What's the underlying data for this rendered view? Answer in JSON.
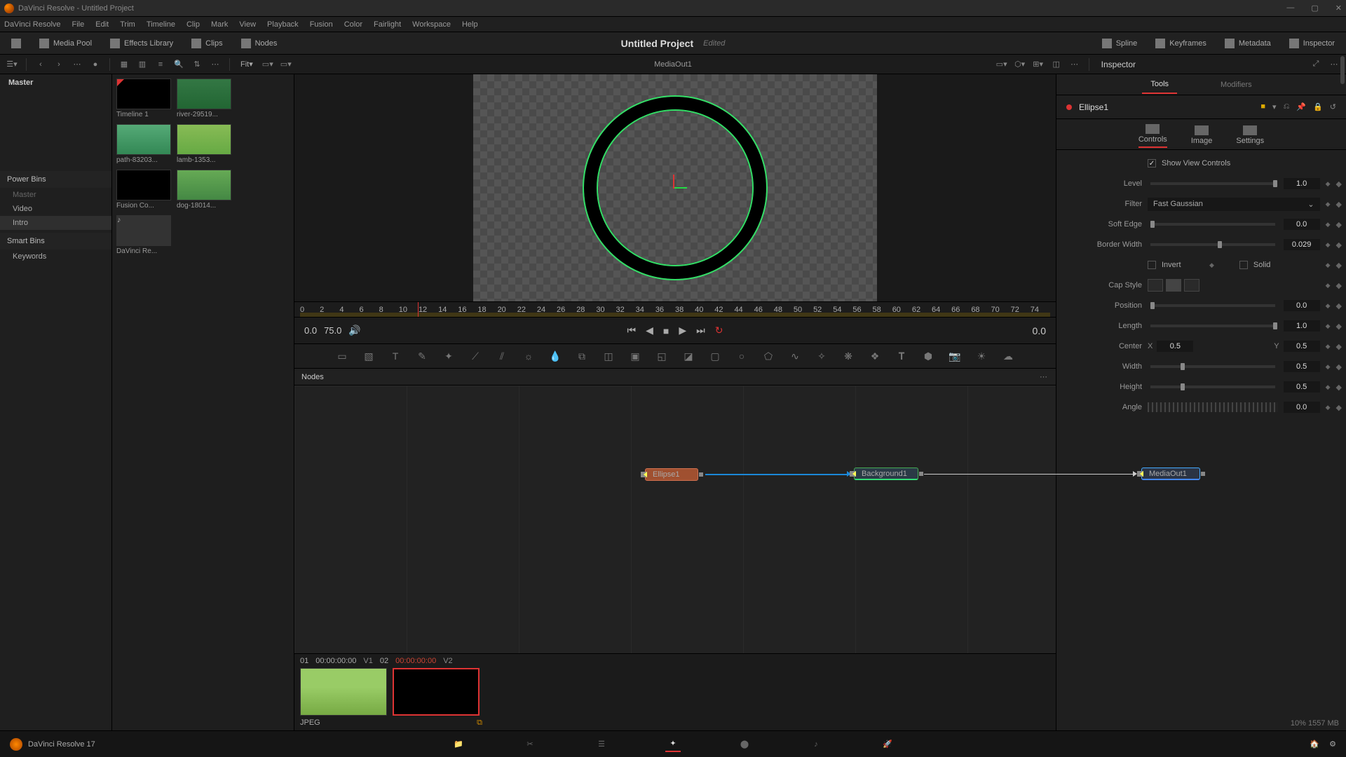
{
  "titlebar": {
    "text": "DaVinci Resolve - Untitled Project"
  },
  "menubar": [
    "DaVinci Resolve",
    "File",
    "Edit",
    "Trim",
    "Timeline",
    "Clip",
    "Mark",
    "View",
    "Playback",
    "Fusion",
    "Color",
    "Fairlight",
    "Workspace",
    "Help"
  ],
  "topbar": {
    "media_pool": "Media Pool",
    "effects_library": "Effects Library",
    "clips": "Clips",
    "nodes": "Nodes",
    "project_name": "Untitled Project",
    "project_state": "Edited",
    "spline": "Spline",
    "keyframes": "Keyframes",
    "metadata": "Metadata",
    "inspector": "Inspector"
  },
  "toolbar2": {
    "fit": "Fit",
    "viewer_label": "MediaOut1",
    "inspector_label": "Inspector"
  },
  "bins": {
    "master": "Master",
    "power_bins": "Power Bins",
    "power_items": [
      "Master",
      "Video",
      "Intro"
    ],
    "smart_bins": "Smart Bins",
    "smart_items": [
      "Keywords"
    ]
  },
  "media_items": [
    {
      "name": "Timeline 1",
      "kind": "timeline"
    },
    {
      "name": "river-29519...",
      "kind": "forest"
    },
    {
      "name": "path-83203...",
      "kind": "path"
    },
    {
      "name": "lamb-1353...",
      "kind": "lamb"
    },
    {
      "name": "Fusion Co...",
      "kind": "fusion"
    },
    {
      "name": "dog-18014...",
      "kind": "dog"
    },
    {
      "name": "DaVinci Re...",
      "kind": "audio"
    }
  ],
  "ruler_ticks": [
    "0",
    "2",
    "4",
    "6",
    "8",
    "10",
    "12",
    "14",
    "16",
    "18",
    "20",
    "22",
    "24",
    "26",
    "28",
    "30",
    "32",
    "34",
    "36",
    "38",
    "40",
    "42",
    "44",
    "46",
    "48",
    "50",
    "52",
    "54",
    "56",
    "58",
    "60",
    "62",
    "64",
    "66",
    "68",
    "70",
    "72",
    "74"
  ],
  "transport": {
    "start": "0.0",
    "end": "75.0",
    "current": "0.0"
  },
  "nodes_hdr": "Nodes",
  "nodes": {
    "ellipse": "Ellipse1",
    "background": "Background1",
    "mediaout": "MediaOut1"
  },
  "clipstrip": {
    "idx1": "01",
    "tc1": "00:00:00:00",
    "v1": "V1",
    "idx2": "02",
    "tc2": "00:00:00:00",
    "v2": "V2",
    "format": "JPEG"
  },
  "mem": "10%   1557 MB",
  "pagebar": {
    "app": "DaVinci Resolve 17"
  },
  "inspector": {
    "tabs": {
      "tools": "Tools",
      "modifiers": "Modifiers"
    },
    "node": "Ellipse1",
    "subtabs": {
      "controls": "Controls",
      "image": "Image",
      "settings": "Settings"
    },
    "show_view_controls": "Show View Controls",
    "level_lbl": "Level",
    "level_val": "1.0",
    "filter_lbl": "Filter",
    "filter_val": "Fast Gaussian",
    "softedge_lbl": "Soft Edge",
    "softedge_val": "0.0",
    "border_lbl": "Border Width",
    "border_val": "0.029",
    "invert_lbl": "Invert",
    "solid_lbl": "Solid",
    "cap_lbl": "Cap Style",
    "position_lbl": "Position",
    "position_val": "0.0",
    "length_lbl": "Length",
    "length_val": "1.0",
    "center_lbl": "Center",
    "center_x_lbl": "X",
    "center_x": "0.5",
    "center_y_lbl": "Y",
    "center_y": "0.5",
    "width_lbl": "Width",
    "width_val": "0.5",
    "height_lbl": "Height",
    "height_val": "0.5",
    "angle_lbl": "Angle",
    "angle_val": "0.0"
  }
}
